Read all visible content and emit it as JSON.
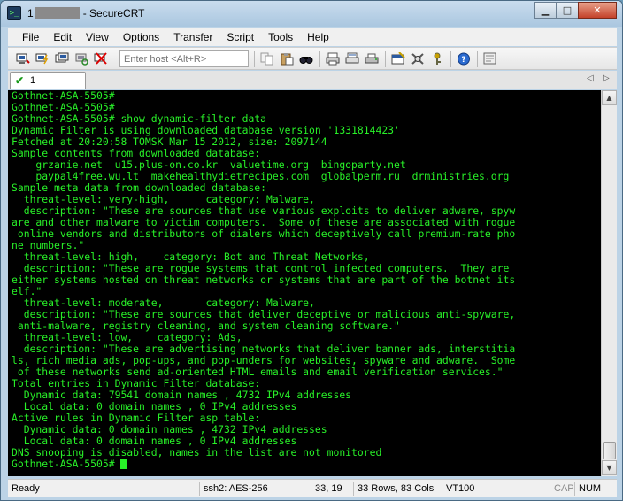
{
  "titlebar": {
    "prefix": "1",
    "app_name": "SecureCRT",
    "minimize": "▁",
    "maximize": "□",
    "close": "✕"
  },
  "menu": [
    "File",
    "Edit",
    "View",
    "Options",
    "Transfer",
    "Script",
    "Tools",
    "Help"
  ],
  "toolbar": {
    "host_placeholder": "Enter host <Alt+R>",
    "icons": [
      "connect-icon",
      "quick-connect-icon",
      "connect-tab-icon",
      "reconnect-icon",
      "disconnect-icon",
      "copy-icon",
      "paste-icon",
      "find-icon",
      "print-icon",
      "print-setup-icon",
      "printer-icon",
      "session-options-icon",
      "global-options-icon",
      "keymap-icon",
      "help-icon",
      "sftp-icon"
    ]
  },
  "tab": {
    "label": "1",
    "nav_left": "◁",
    "nav_right": "▷"
  },
  "terminal": {
    "lines": [
      "Gothnet-ASA-5505#",
      "Gothnet-ASA-5505#",
      "Gothnet-ASA-5505# show dynamic-filter data",
      "Dynamic Filter is using downloaded database version '1331814423'",
      "Fetched at 20:20:58 TOMSK Mar 15 2012, size: 2097144",
      "Sample contents from downloaded database:",
      "    grzanie.net  u15.plus-on.co.kr  valuetime.org  bingoparty.net",
      "    paypal4free.wu.lt  makehealthydietrecipes.com  globalperm.ru  drministries.org",
      "Sample meta data from downloaded database:",
      "  threat-level: very-high,      category: Malware,",
      "  description: \"These are sources that use various exploits to deliver adware, spyw",
      "are and other malware to victim computers.  Some of these are associated with rogue",
      " online vendors and distributors of dialers which deceptively call premium-rate pho",
      "ne numbers.\"",
      "  threat-level: high,    category: Bot and Threat Networks,",
      "  description: \"These are rogue systems that control infected computers.  They are",
      "either systems hosted on threat networks or systems that are part of the botnet its",
      "elf.\"",
      "  threat-level: moderate,       category: Malware,",
      "  description: \"These are sources that deliver deceptive or malicious anti-spyware,",
      " anti-malware, registry cleaning, and system cleaning software.\"",
      "  threat-level: low,    category: Ads,",
      "  description: \"These are advertising networks that deliver banner ads, interstitia",
      "ls, rich media ads, pop-ups, and pop-unders for websites, spyware and adware.  Some",
      " of these networks send ad-oriented HTML emails and email verification services.\"",
      "Total entries in Dynamic Filter database:",
      "  Dynamic data: 79541 domain names , 4732 IPv4 addresses",
      "  Local data: 0 domain names , 0 IPv4 addresses",
      "Active rules in Dynamic Filter asp table:",
      "  Dynamic data: 0 domain names , 4732 IPv4 addresses",
      "  Local data: 0 domain names , 0 IPv4 addresses",
      "DNS snooping is disabled, names in the list are not monitored",
      "Gothnet-ASA-5505# "
    ]
  },
  "scrollbar": {
    "up": "▲",
    "down": "▼"
  },
  "status": {
    "ready": "Ready",
    "protocol": "ssh2: AES-256",
    "position": "33, 19",
    "size": "33 Rows, 83 Cols",
    "emulation": "VT100",
    "cap": "CAP",
    "num": "NUM"
  },
  "colors": {
    "terminal_bg": "#000000",
    "terminal_fg": "#28f028",
    "chrome": "#bcd3e6"
  }
}
